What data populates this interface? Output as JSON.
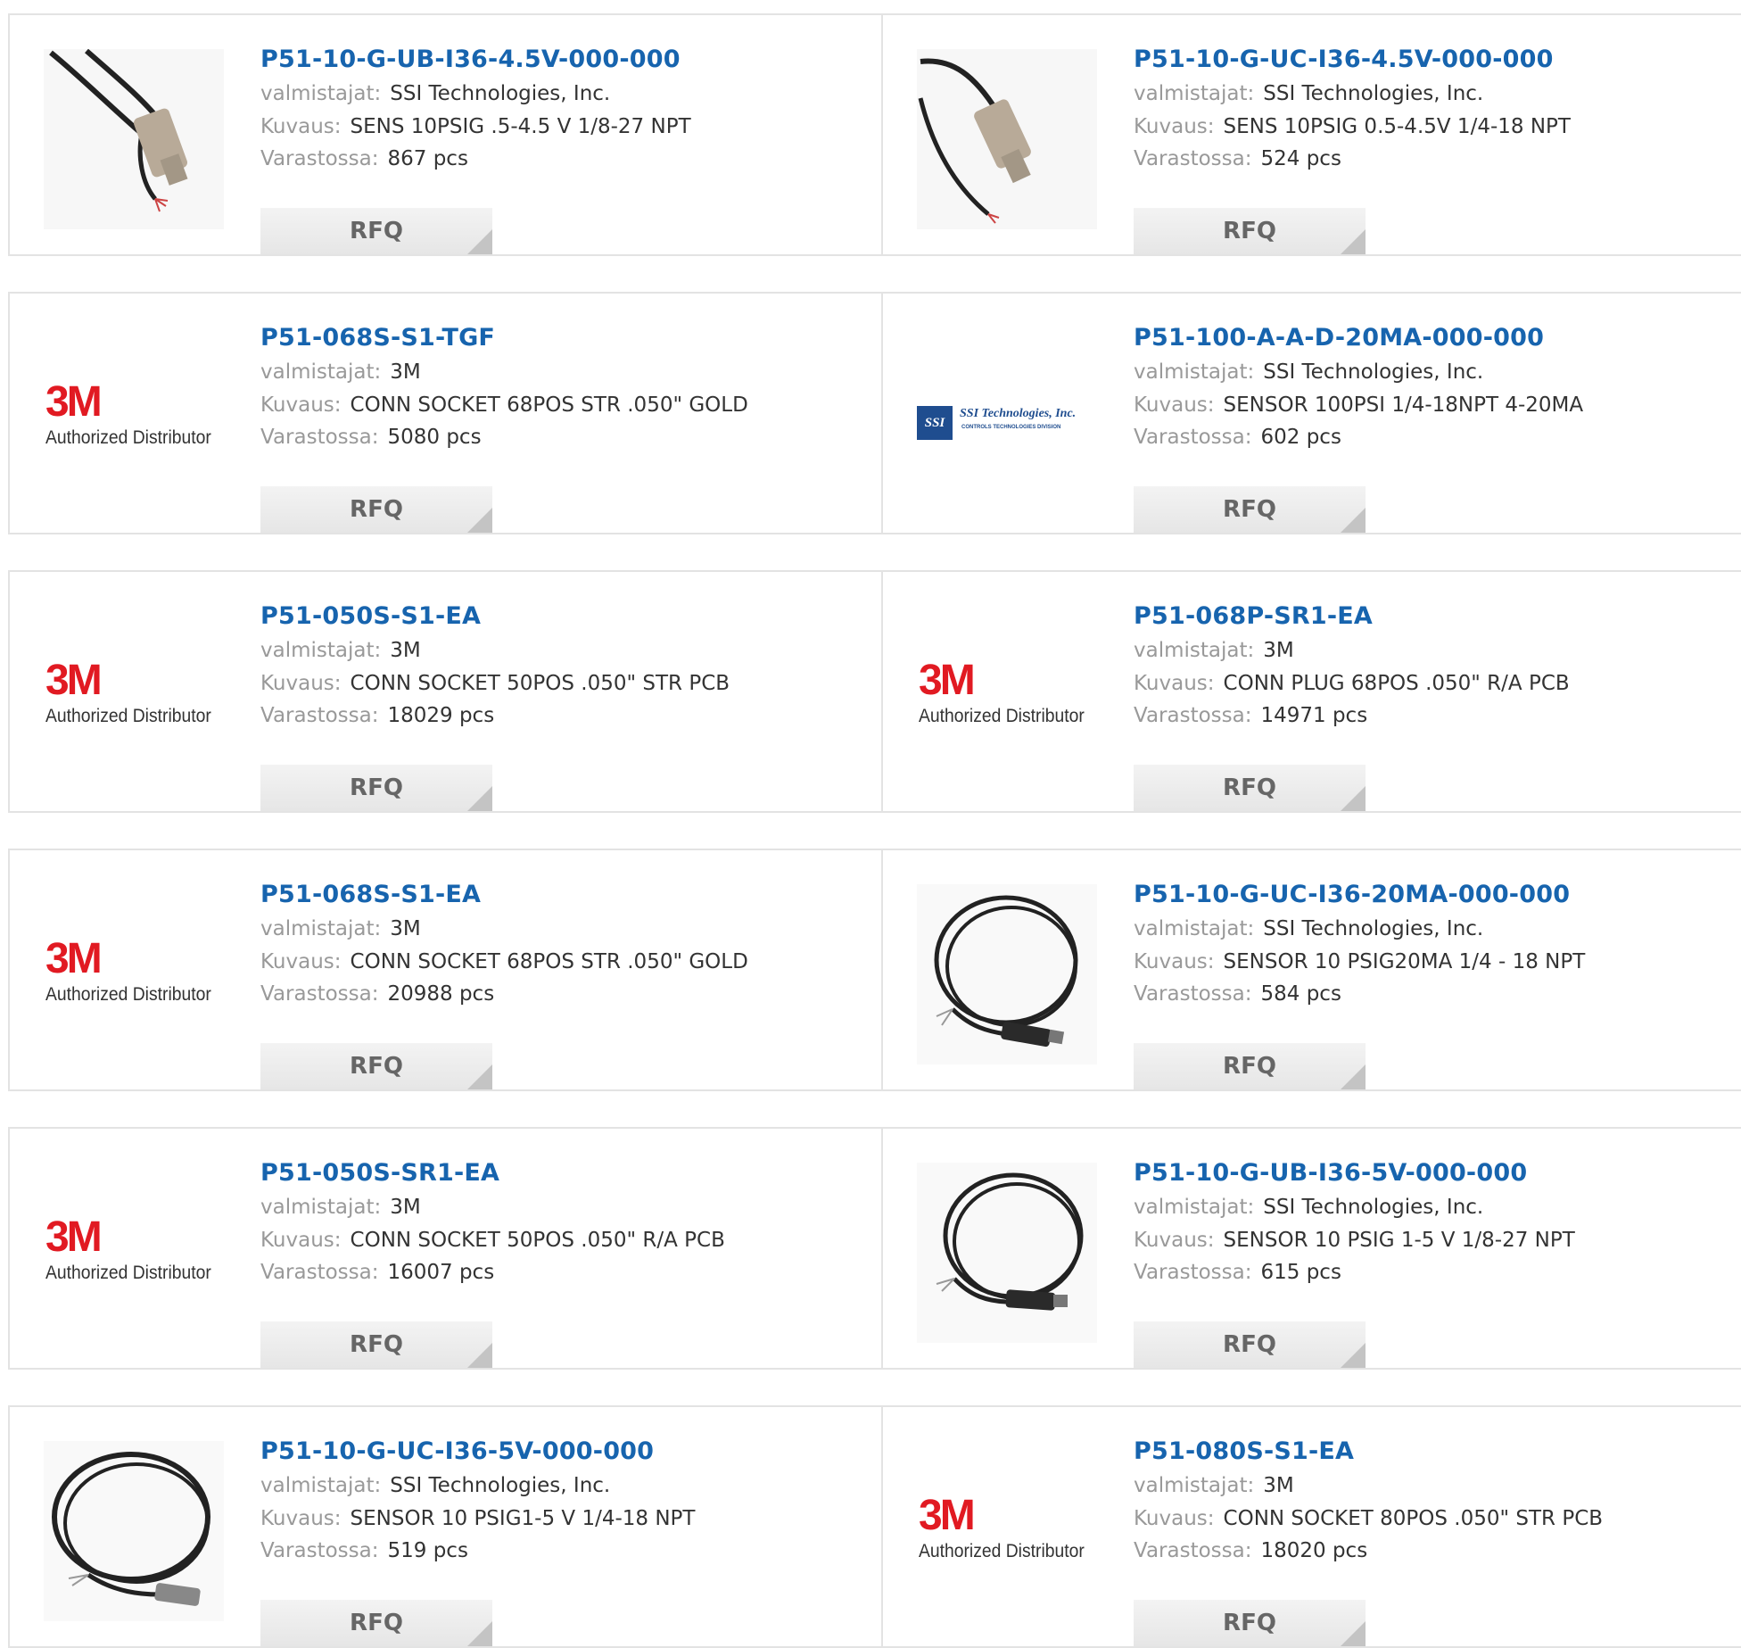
{
  "labels": {
    "manufacturer": "valmistajat:",
    "description": "Kuvaus:",
    "stock": "Varastossa:",
    "rfq": "RFQ",
    "brand_3m_mark": "3M",
    "brand_3m_tagline": "Authorized Distributor",
    "brand_ssi_name": "SSI Technologies, Inc.",
    "brand_ssi_sub": "CONTROLS TECHNOLOGIES DIVISION",
    "brand_ssi_mark": "SSI"
  },
  "products": [
    {
      "part": "P51-10-G-UB-I36-4.5V-000-000",
      "manufacturer": "SSI Technologies, Inc.",
      "description": "SENS 10PSIG .5-4.5 V 1/8-27 NPT",
      "stock": "867 pcs",
      "image": "pressure-sensor-photo"
    },
    {
      "part": "P51-10-G-UC-I36-4.5V-000-000",
      "manufacturer": "SSI Technologies, Inc.",
      "description": "SENS 10PSIG 0.5-4.5V 1/4-18 NPT",
      "stock": "524 pcs",
      "image": "pressure-sensor-photo"
    },
    {
      "part": "P51-068S-S1-TGF",
      "manufacturer": "3M",
      "description": "CONN SOCKET 68POS STR .050\" GOLD",
      "stock": "5080 pcs",
      "image": "3m-logo"
    },
    {
      "part": "P51-100-A-A-D-20MA-000-000",
      "manufacturer": "SSI Technologies, Inc.",
      "description": "SENSOR 100PSI 1/4-18NPT 4-20MA",
      "stock": "602 pcs",
      "image": "ssi-logo"
    },
    {
      "part": "P51-050S-S1-EA",
      "manufacturer": "3M",
      "description": "CONN SOCKET 50POS .050\" STR PCB",
      "stock": "18029 pcs",
      "image": "3m-logo"
    },
    {
      "part": "P51-068P-SR1-EA",
      "manufacturer": "3M",
      "description": "CONN PLUG 68POS .050\" R/A PCB",
      "stock": "14971 pcs",
      "image": "3m-logo"
    },
    {
      "part": "P51-068S-S1-EA",
      "manufacturer": "3M",
      "description": "CONN SOCKET 68POS STR .050\" GOLD",
      "stock": "20988 pcs",
      "image": "3m-logo"
    },
    {
      "part": "P51-10-G-UC-I36-20MA-000-000",
      "manufacturer": "SSI Technologies, Inc.",
      "description": "SENSOR 10 PSIG20MA 1/4 - 18 NPT",
      "stock": "584 pcs",
      "image": "coiled-sensor-photo"
    },
    {
      "part": "P51-050S-SR1-EA",
      "manufacturer": "3M",
      "description": "CONN SOCKET 50POS .050\" R/A PCB",
      "stock": "16007 pcs",
      "image": "3m-logo"
    },
    {
      "part": "P51-10-G-UB-I36-5V-000-000",
      "manufacturer": "SSI Technologies, Inc.",
      "description": "SENSOR 10 PSIG 1-5 V 1/8-27 NPT",
      "stock": "615 pcs",
      "image": "coiled-sensor-photo"
    },
    {
      "part": "P51-10-G-UC-I36-5V-000-000",
      "manufacturer": "SSI Technologies, Inc.",
      "description": "SENSOR 10 PSIG1-5 V 1/4-18 NPT",
      "stock": "519 pcs",
      "image": "coiled-sensor-photo"
    },
    {
      "part": "P51-080S-S1-EA",
      "manufacturer": "3M",
      "description": "CONN SOCKET 80POS .050\" STR PCB",
      "stock": "18020 pcs",
      "image": "3m-logo"
    }
  ]
}
